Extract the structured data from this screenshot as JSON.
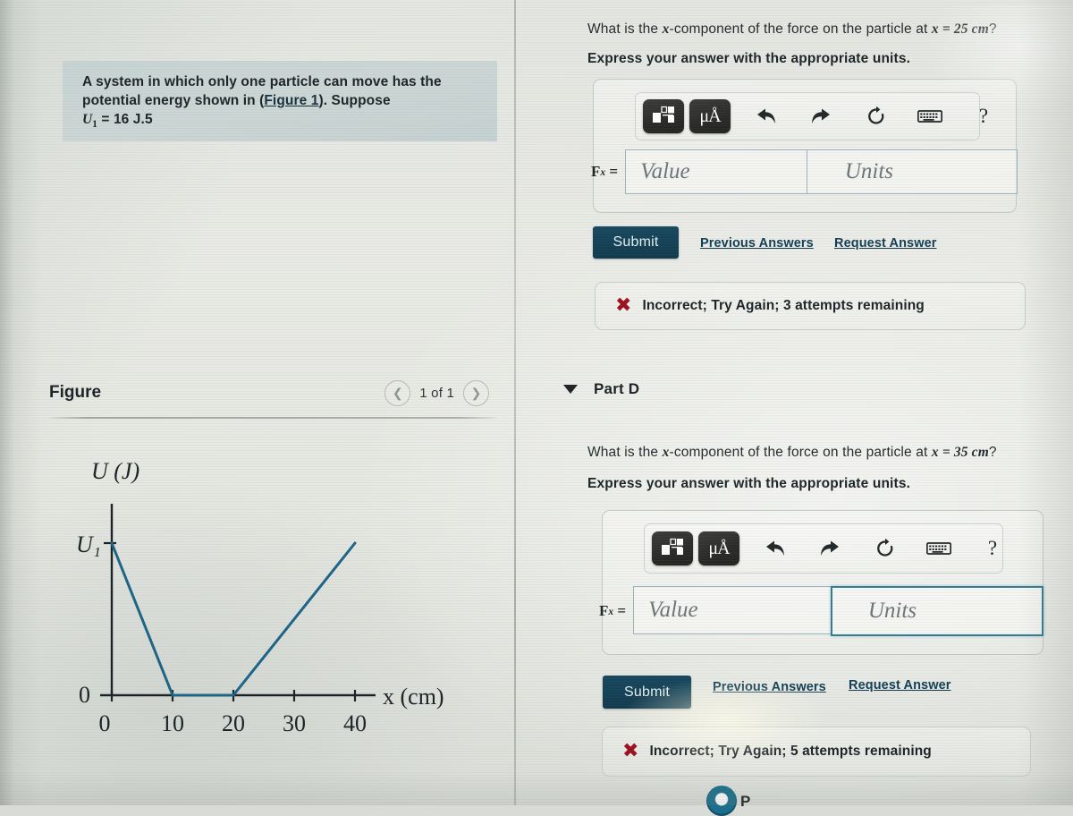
{
  "problem": {
    "text_line1": "A system in which only one particle can move has the",
    "text_line2_pre": "potential energy shown in (",
    "figure_link": "Figure 1",
    "text_line2_post": "). Suppose",
    "given_symbol": "U",
    "given_sub": "1",
    "given_value": "= 16 J.5"
  },
  "figure": {
    "title": "Figure",
    "counter": "1 of 1",
    "prev_icon": "chevron-left-icon",
    "next_icon": "chevron-right-icon"
  },
  "chart_data": {
    "type": "line",
    "title": "",
    "xlabel": "x (cm)",
    "ylabel": "U (J)",
    "x": [
      0,
      10,
      20,
      40
    ],
    "y": [
      16,
      0,
      0,
      16
    ],
    "xticks": [
      0,
      10,
      20,
      30,
      40
    ],
    "xticklabels": [
      "0",
      "10",
      "20",
      "30",
      "40"
    ],
    "yticks": [
      0,
      16
    ],
    "yticklabels": [
      "0",
      "U1"
    ],
    "y_axis_top_label": "U₁",
    "y_axis_zero_label": "0",
    "x_axis_origin_label": "0",
    "xlim": [
      0,
      46
    ],
    "ylim": [
      0,
      18
    ],
    "grid": false,
    "legend": false,
    "line_color": "#1c6487",
    "line_width": 3,
    "annotation": "Piecewise linear: falls from U1 at x=0 to 0 at x=10, flat 0 from x=10 to x=20, rises linearly from x=20 to U1 at x=40"
  },
  "partC": {
    "question_pre": "What is the ",
    "question_var": "x",
    "question_mid": "-component of the force on the particle at ",
    "question_cond": "x = 25 cm",
    "question_post": "?",
    "instruction": "Express your answer with the appropriate units.",
    "toolbar": {
      "template_icon": "math-template-icon",
      "units_icon": "micro-angstrom-units-icon",
      "units_label": "μÅ",
      "undo_icon": "undo-arrow-icon",
      "redo_icon": "redo-arrow-icon",
      "reset_icon": "reset-circular-arrow-icon",
      "keyboard_icon": "keyboard-icon",
      "help_icon": "question-mark-help-icon",
      "help_label": "?"
    },
    "field_label": "F",
    "field_label_sub": "x",
    "field_label_eq": "=",
    "value_placeholder": "Value",
    "units_placeholder": "Units",
    "value_current": "",
    "units_current": "",
    "submit_label": "Submit",
    "previous_answers_label": "Previous Answers",
    "request_answer_label": "Request Answer",
    "feedback_icon": "red-x-icon",
    "feedback_mark": "✖",
    "feedback_text": "Incorrect; Try Again; 3 attempts remaining",
    "feedback_color": "#9e1020"
  },
  "partD": {
    "caret_icon": "caret-down-icon",
    "label": "Part D",
    "question_pre": "What is the ",
    "question_var": "x",
    "question_mid": "-component of the force on the particle at ",
    "question_cond": "x = 35 cm",
    "question_post": "?",
    "instruction": "Express your answer with the appropriate units.",
    "toolbar": {
      "template_icon": "math-template-icon",
      "units_icon": "micro-angstrom-units-icon",
      "units_label": "μÅ",
      "undo_icon": "undo-arrow-icon",
      "redo_icon": "redo-arrow-icon",
      "reset_icon": "reset-circular-arrow-icon",
      "keyboard_icon": "keyboard-icon",
      "help_icon": "question-mark-help-icon",
      "help_label": "?"
    },
    "field_label": "F",
    "field_label_sub": "x",
    "field_label_eq": "=",
    "value_placeholder": "Value",
    "units_placeholder": "Units",
    "value_current": "",
    "units_current": "",
    "units_focused": true,
    "submit_label": "Submit",
    "previous_answers_label": "Previous Answers",
    "request_answer_label": "Request Answer",
    "feedback_icon": "red-x-icon",
    "feedback_mark": "✖",
    "feedback_text": "Incorrect; Try Again; 5 attempts remaining",
    "feedback_color": "#9e1020"
  },
  "partE_peek": {
    "label": "P",
    "icon": "part-status-circle-icon"
  },
  "colors": {
    "accent": "#14445e",
    "link": "#123d52",
    "chart_line": "#1c6487",
    "focus_border": "#2f7d96",
    "problem_box_bg": "#c8d4d4",
    "error": "#9e1020"
  }
}
